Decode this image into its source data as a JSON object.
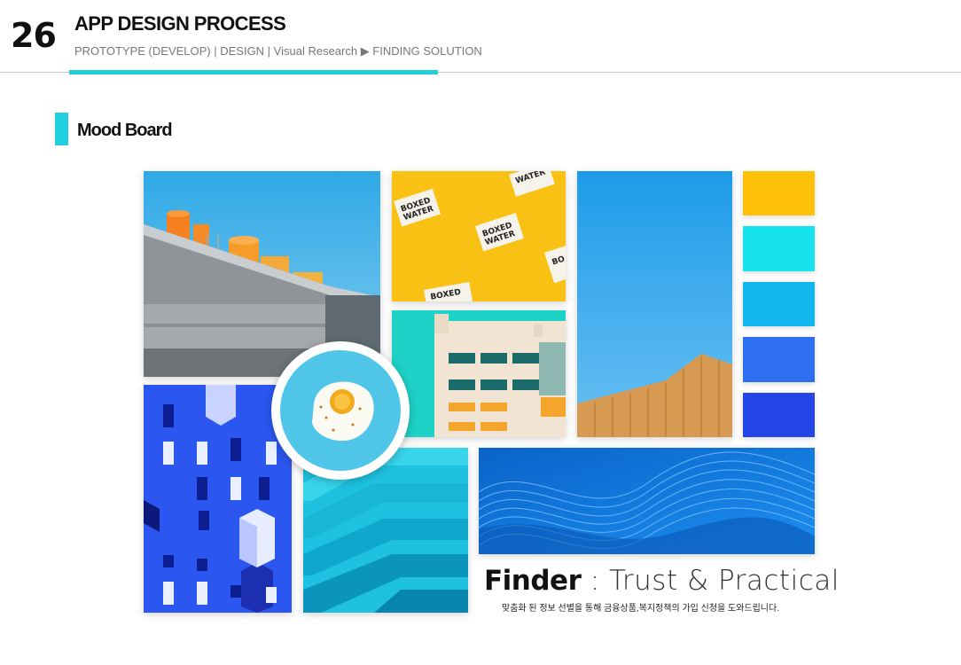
{
  "header": {
    "page_number": "26",
    "title": "APP DESIGN PROCESS",
    "subtitle": "PROTOTYPE (DEVELOP) | DESIGN | Visual Research ▶ FINDING SOLUTION"
  },
  "section": {
    "title": "Mood Board"
  },
  "tagline": {
    "brand": "Finder",
    "separator": " : ",
    "slogan": "Trust & Practical",
    "caption": "맞춤화 된 정보 선별을 통해 금융상품,복지정책의 가입 신청을 도와드립니다."
  },
  "tiles": {
    "boxed_water_text": "BOXED WATER"
  },
  "palette": {
    "accent": "#1fd0db",
    "swatches": [
      "#ffc107",
      "#17e3ec",
      "#12b6ee",
      "#2e6ff2",
      "#2446e8"
    ]
  }
}
